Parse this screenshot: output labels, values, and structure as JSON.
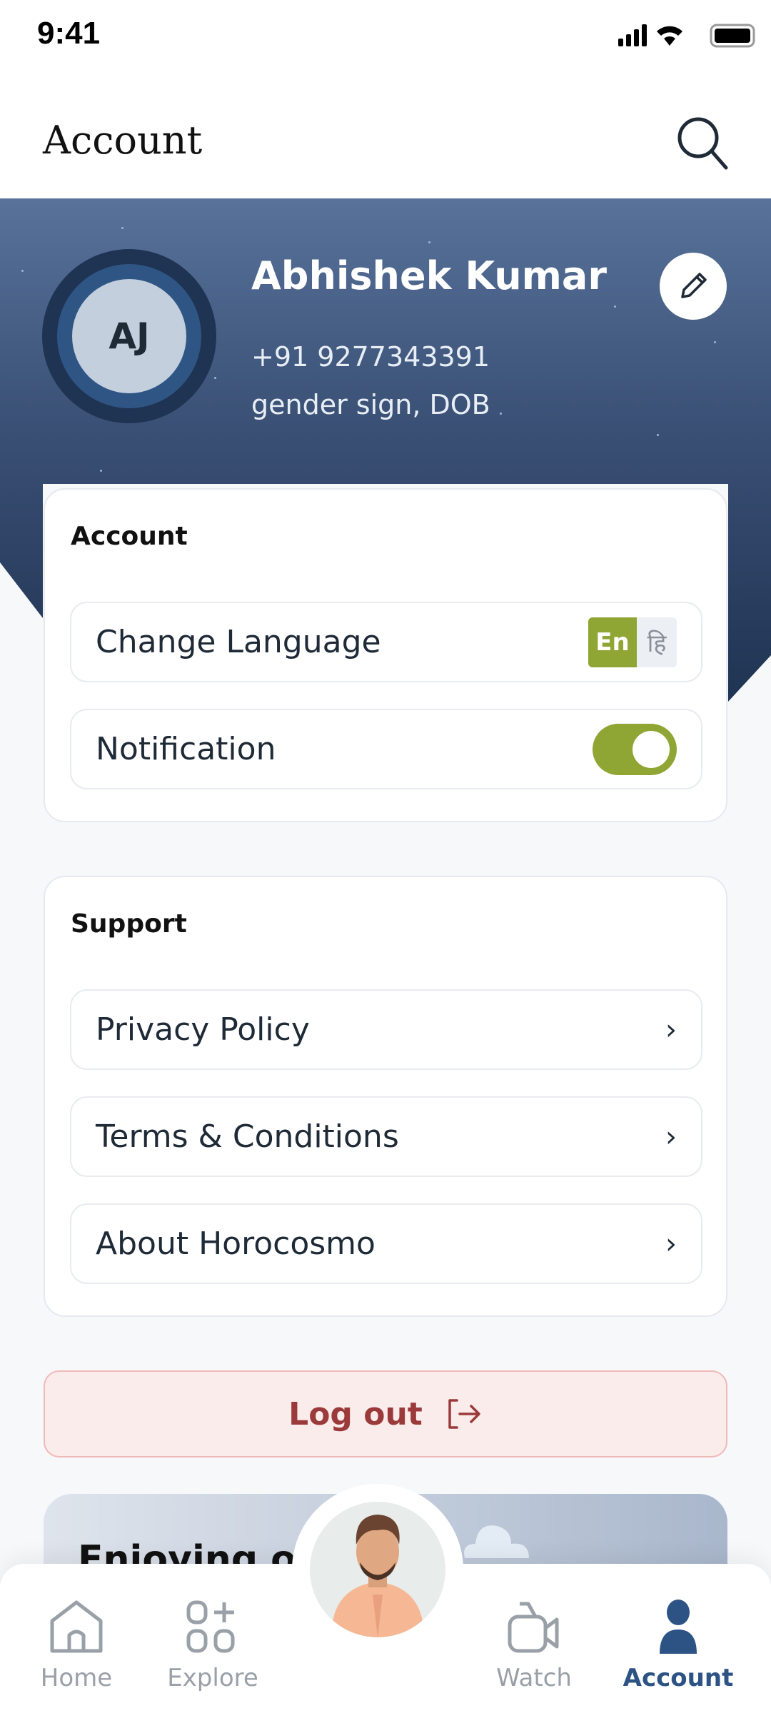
{
  "status_bar": {
    "time": "9:41"
  },
  "header": {
    "title": "Account",
    "search_icon": "search-icon"
  },
  "profile": {
    "initials": "AJ",
    "name": "Abhishek Kumar",
    "phone": "+91 9277343391",
    "details": "gender sign, DOB",
    "edit_icon": "pencil-icon"
  },
  "account_section": {
    "title": "Account",
    "items": [
      {
        "label": "Change Language",
        "options": [
          "En",
          "हि"
        ],
        "selected": "En"
      },
      {
        "label": "Notification",
        "enabled": true
      }
    ]
  },
  "support_section": {
    "title": "Support",
    "items": [
      {
        "label": "Privacy Policy"
      },
      {
        "label": "Terms & Conditions"
      },
      {
        "label": "About Horocosmo"
      }
    ]
  },
  "logout": {
    "label": "Log out",
    "icon": "logout-icon"
  },
  "promo": {
    "title": "Enjoying ou"
  },
  "nav": {
    "items": [
      {
        "label": "Home",
        "icon": "home-icon"
      },
      {
        "label": "Explore",
        "icon": "explore-icon"
      },
      {
        "label": "Watch",
        "icon": "video-icon"
      },
      {
        "label": "Account",
        "icon": "user-icon",
        "active": true
      }
    ]
  },
  "colors": {
    "accent": "#8fa534",
    "primary": "#2d5385",
    "banner": "#1f3352",
    "logout_text": "#9b3a3a"
  }
}
